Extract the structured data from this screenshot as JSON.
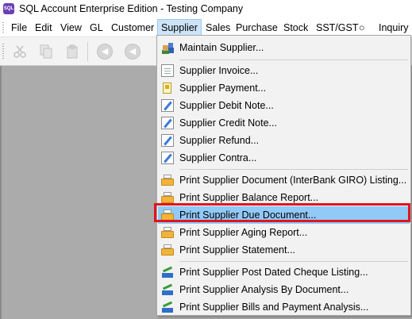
{
  "window": {
    "title": "SQL Account Enterprise Edition - Testing Company",
    "icon_text": "SQL"
  },
  "menubar": {
    "items": [
      {
        "label": "File"
      },
      {
        "label": "Edit"
      },
      {
        "label": "View"
      },
      {
        "label": "GL"
      },
      {
        "label": "Customer"
      },
      {
        "label": "Supplier"
      },
      {
        "label": "Sales"
      },
      {
        "label": "Purchase"
      },
      {
        "label": "Stock"
      },
      {
        "label": "SST/GST"
      },
      {
        "label": "○"
      },
      {
        "label": "Inquiry"
      }
    ],
    "active": "Supplier"
  },
  "toolbar": {
    "buttons": [
      "cut-icon",
      "copy-icon",
      "paste-icon",
      "first-record-icon",
      "previous-record-icon"
    ]
  },
  "supplier_menu": {
    "items": [
      {
        "label": "Maintain Supplier...",
        "icon": "people-icon"
      },
      {
        "label": "Supplier Invoice...",
        "icon": "document-icon"
      },
      {
        "label": "Supplier Payment...",
        "icon": "payment-icon"
      },
      {
        "label": "Supplier Debit Note...",
        "icon": "note-icon"
      },
      {
        "label": "Supplier Credit Note...",
        "icon": "note-icon"
      },
      {
        "label": "Supplier Refund...",
        "icon": "refund-icon"
      },
      {
        "label": "Supplier Contra...",
        "icon": "contra-icon"
      },
      {
        "label": "Print Supplier Document (InterBank GIRO) Listing...",
        "icon": "printer-icon"
      },
      {
        "label": "Print Supplier Balance Report...",
        "icon": "printer-icon"
      },
      {
        "label": "Print Supplier Due Document...",
        "icon": "printer-icon"
      },
      {
        "label": "Print Supplier Aging Report...",
        "icon": "printer-icon"
      },
      {
        "label": "Print Supplier Statement...",
        "icon": "printer-icon"
      },
      {
        "label": "Print Supplier Post Dated Cheque Listing...",
        "icon": "chart-icon"
      },
      {
        "label": "Print Supplier Analysis By Document...",
        "icon": "chart-icon"
      },
      {
        "label": "Print Supplier Bills and Payment Analysis...",
        "icon": "chart-icon"
      }
    ],
    "highlighted": "Print Supplier Due Document..."
  },
  "colors": {
    "highlight": "#91c9f7",
    "annotation_box": "#e0141e",
    "workspace": "#ababab"
  }
}
